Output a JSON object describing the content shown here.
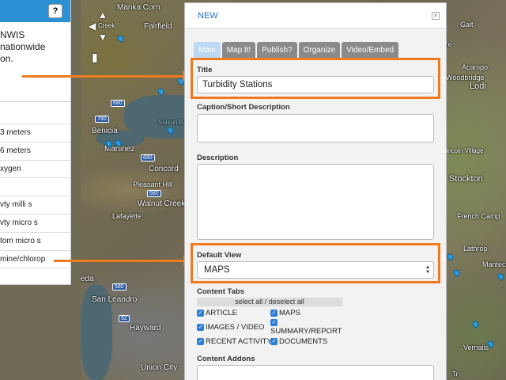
{
  "left_panel": {
    "help_label": "?",
    "intro_line1": "NWIS nationwide",
    "intro_line2": "on.",
    "rows": [
      "3 meters",
      "6 meters",
      "xygen",
      "",
      "vty milli s",
      "vty micro s",
      "tom micro s",
      "mine/chlorop"
    ]
  },
  "map": {
    "cities": [
      "Fairfield",
      "Benicia",
      "Martinez",
      "Concord",
      "Pleasant Hill",
      "Walnut Creek",
      "Lafayette",
      "San Leandro",
      "Hayward",
      "Union City",
      "Suisun Ba",
      "Stockton",
      "French Camp",
      "Lathrop",
      "Manteca",
      "Vernalis",
      "Acampo",
      "Woodbridge",
      "Lodi",
      "Lincoln Village",
      "Galt",
      "Manka Corn",
      "eda",
      "Creek",
      "Cre",
      "Tr"
    ],
    "shields": [
      "680",
      "780",
      "680",
      "680",
      "580",
      "92"
    ],
    "marker_color": "#2b9de0"
  },
  "dialog": {
    "title": "NEW",
    "close_label": "×",
    "tabs": [
      "Main",
      "Map It!",
      "Publish?",
      "Organize",
      "Video/Embed"
    ],
    "active_tab": "Main",
    "title_label": "Title",
    "title_value": "Turbidity Stations",
    "caption_label": "Caption/Short Description",
    "caption_value": "",
    "description_label": "Description",
    "description_value": "",
    "default_view_label": "Default View",
    "default_view_value": "MAPS",
    "content_tabs_label": "Content Tabs",
    "select_all_label": "select all / deselect all",
    "checkboxes": {
      "article": "ARTICLE",
      "maps": "MAPS",
      "images_video": "IMAGES / VIDEO",
      "summary_report": "SUMMARY/REPORT",
      "recent_activity": "RECENT ACTIVITY",
      "documents": "DOCUMENTS"
    },
    "content_addons_label": "Content Addons"
  },
  "colors": {
    "highlight": "#f07a20",
    "accent": "#2b8fd4",
    "tab_active": "#bcd8f4",
    "tab_inactive": "#8a8a8a"
  }
}
